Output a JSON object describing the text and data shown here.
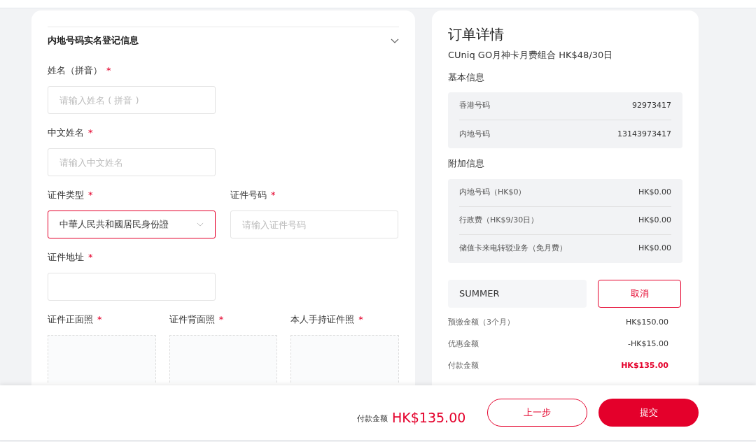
{
  "registration": {
    "title": "内地号码实名登记信息",
    "expanded": true,
    "fields": [
      {
        "kind": "input",
        "label": "姓名（拼音）",
        "required_mark": "*",
        "placeholder": "请输入姓名 ( 拼音 )"
      },
      {
        "kind": "input",
        "label": "中文姓名",
        "required_mark": "*",
        "placeholder": "请输入中文姓名"
      },
      {
        "kind": "select",
        "label": "证件类型",
        "required_mark": "*",
        "value": "中華人民共和國居民身份證",
        "error": true
      },
      {
        "kind": "input",
        "label": "证件号码",
        "required_mark": "*",
        "placeholder": "请输入证件号码"
      },
      {
        "kind": "input",
        "label": "证件地址",
        "required_mark": "*"
      }
    ],
    "uploads": [
      {
        "label": "证件正面照",
        "required_mark": "*"
      },
      {
        "label": "证件背面照",
        "required_mark": "*"
      },
      {
        "label": "本人手持证件照",
        "required_mark": "*"
      }
    ]
  },
  "order": {
    "title": "订单详情",
    "plan": "CUniq GO月神卡月费组合 HK$48/30日",
    "basic_title": "基本信息",
    "basic": [
      {
        "label": "香港号码",
        "value": "92973417"
      },
      {
        "label": "内地号码",
        "value": "13143973417"
      }
    ],
    "extra_title": "附加信息",
    "extra": [
      {
        "label": "内地号码（HK$0）",
        "value": "HK$0.00"
      },
      {
        "label": "行政费（HK$9/30日）",
        "value": "HK$0.00"
      },
      {
        "label": "储值卡来电转驳业务（免月费）",
        "value": "HK$0.00"
      }
    ],
    "coupon": {
      "value": "SUMMER",
      "button": "取消"
    },
    "summary": [
      {
        "label": "预缴金额（3个月）",
        "value": "HK$150.00",
        "highlight": false
      },
      {
        "label": "优惠金额",
        "value": "-HK$15.00",
        "highlight": false
      },
      {
        "label": "付款金额",
        "value": "HK$135.00",
        "highlight": true
      }
    ]
  },
  "footer": {
    "total_label": "付款金额",
    "total": "HK$135.00",
    "back": "上一步",
    "submit": "提交"
  }
}
